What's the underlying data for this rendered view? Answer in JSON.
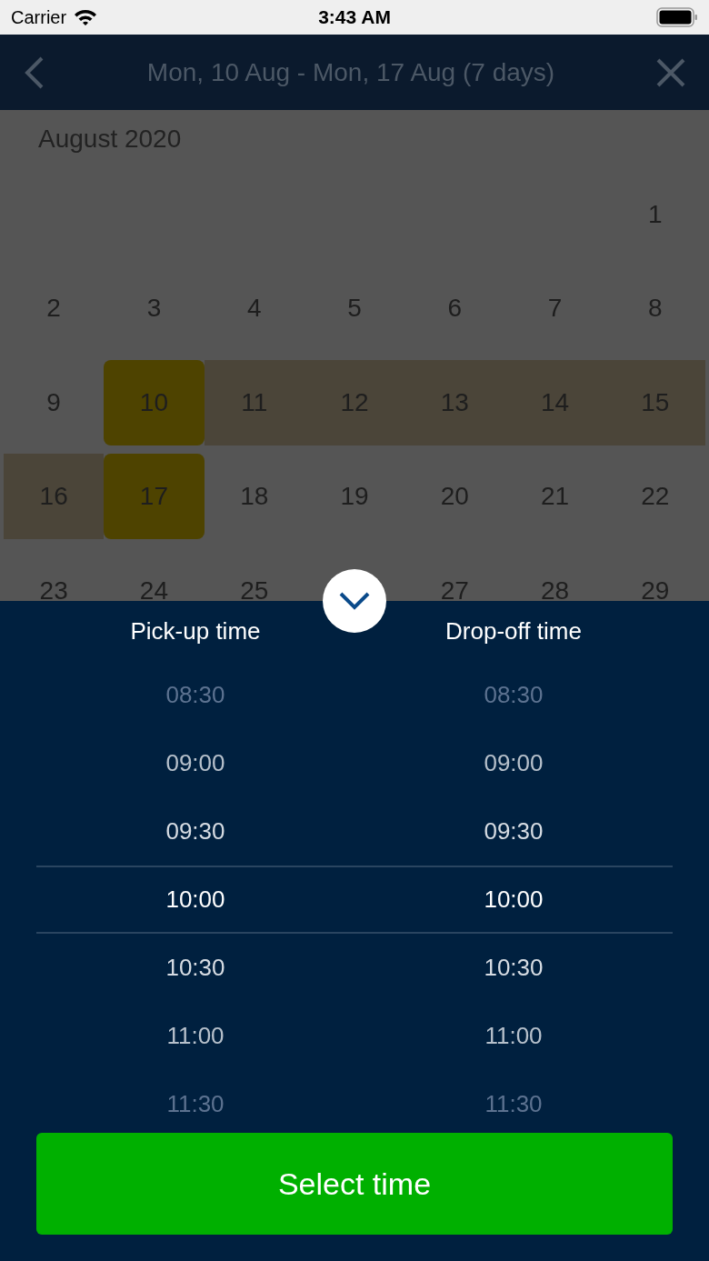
{
  "status_bar": {
    "carrier": "Carrier",
    "time": "3:43 AM"
  },
  "header": {
    "title": "Mon, 10 Aug - Mon, 17 Aug (7 days)"
  },
  "calendar": {
    "month": "August 2020",
    "weeks": [
      [
        {
          "kind": "blank"
        },
        {
          "kind": "blank"
        },
        {
          "kind": "blank"
        },
        {
          "kind": "blank"
        },
        {
          "kind": "blank"
        },
        {
          "kind": "blank"
        },
        {
          "kind": "day",
          "day": "1",
          "selected": false,
          "in_range": false
        }
      ],
      [
        {
          "day": "2",
          "selected": false,
          "in_range": false
        },
        {
          "day": "3",
          "selected": false,
          "in_range": false
        },
        {
          "day": "4",
          "selected": false,
          "in_range": false
        },
        {
          "day": "5",
          "selected": false,
          "in_range": false
        },
        {
          "day": "6",
          "selected": false,
          "in_range": false
        },
        {
          "day": "7",
          "selected": false,
          "in_range": false
        },
        {
          "day": "8",
          "selected": false,
          "in_range": false
        }
      ],
      [
        {
          "day": "9",
          "selected": false,
          "in_range": false
        },
        {
          "day": "10",
          "selected": true,
          "in_range": false
        },
        {
          "day": "11",
          "selected": false,
          "in_range": true
        },
        {
          "day": "12",
          "selected": false,
          "in_range": true
        },
        {
          "day": "13",
          "selected": false,
          "in_range": true
        },
        {
          "day": "14",
          "selected": false,
          "in_range": true
        },
        {
          "day": "15",
          "selected": false,
          "in_range": true
        }
      ],
      [
        {
          "day": "16",
          "selected": false,
          "in_range": true
        },
        {
          "day": "17",
          "selected": true,
          "in_range": false
        },
        {
          "day": "18",
          "selected": false,
          "in_range": false
        },
        {
          "day": "19",
          "selected": false,
          "in_range": false
        },
        {
          "day": "20",
          "selected": false,
          "in_range": false
        },
        {
          "day": "21",
          "selected": false,
          "in_range": false
        },
        {
          "day": "22",
          "selected": false,
          "in_range": false
        }
      ],
      [
        {
          "day": "23",
          "selected": false,
          "in_range": false
        },
        {
          "day": "24",
          "selected": false,
          "in_range": false
        },
        {
          "day": "25",
          "selected": false,
          "in_range": false
        },
        {
          "kind": "blank"
        },
        {
          "day": "27",
          "selected": false,
          "in_range": false
        },
        {
          "day": "28",
          "selected": false,
          "in_range": false
        },
        {
          "day": "29",
          "selected": false,
          "in_range": false
        }
      ]
    ]
  },
  "time_picker": {
    "columns": [
      {
        "label": "Pick-up time",
        "times": [
          {
            "label": "08:30",
            "selected": false
          },
          {
            "label": "09:00",
            "selected": false
          },
          {
            "label": "09:30",
            "selected": false
          },
          {
            "label": "10:00",
            "selected": true
          },
          {
            "label": "10:30",
            "selected": false
          },
          {
            "label": "11:00",
            "selected": false
          },
          {
            "label": "11:30",
            "selected": false
          }
        ]
      },
      {
        "label": "Drop-off time",
        "times": [
          {
            "label": "08:30",
            "selected": false
          },
          {
            "label": "09:00",
            "selected": false
          },
          {
            "label": "09:30",
            "selected": false
          },
          {
            "label": "10:00",
            "selected": true
          },
          {
            "label": "10:30",
            "selected": false
          },
          {
            "label": "11:00",
            "selected": false
          },
          {
            "label": "11:30",
            "selected": false
          }
        ]
      }
    ]
  },
  "button": {
    "label": "Select time"
  }
}
